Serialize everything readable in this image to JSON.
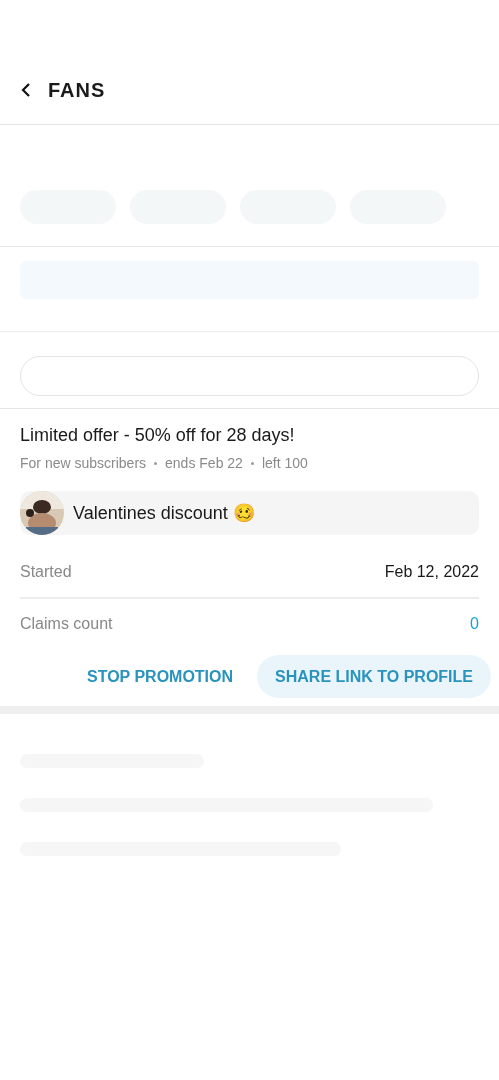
{
  "header": {
    "title": "FANS"
  },
  "promotion": {
    "title": "Limited offer - 50% off for 28 days!",
    "meta": [
      "For new subscribers",
      "ends Feb 22",
      "left 100"
    ],
    "message": {
      "text": "Valentines discount 🥴"
    },
    "details": [
      {
        "label": "Started",
        "value": "Feb 12, 2022",
        "kind": "plain"
      },
      {
        "label": "Claims count",
        "value": "0",
        "kind": "link"
      }
    ],
    "actions": [
      {
        "label": "STOP PROMOTION",
        "kind": "text"
      },
      {
        "label": "SHARE LINK TO PROFILE",
        "kind": "tonal"
      }
    ]
  }
}
